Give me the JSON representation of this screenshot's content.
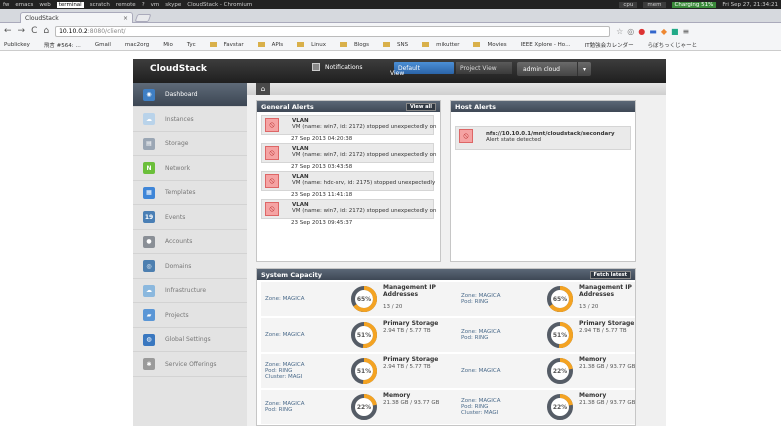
{
  "os_bar": {
    "items": [
      "fw",
      "emacs",
      "web",
      "terminal",
      "scratch",
      "remote",
      "?",
      "vm",
      "skype"
    ],
    "active": "terminal",
    "window_title": "CloudStack - Chromium",
    "cpu": "cpu",
    "mem": "mem",
    "battery": "Charging 51%",
    "clock": "Fri Sep 27, 21:34:21"
  },
  "browser": {
    "tab_title": "CloudStack",
    "tab_close": "×",
    "url_host": "10.10.0.2",
    "url_path": ":8080/client/",
    "nav_back": "←",
    "nav_forward": "→",
    "nav_reload": "C",
    "nav_home": "⌂"
  },
  "bookmarks": [
    "Publickey",
    "飛言 #564: …",
    "Gmail",
    "mac2org",
    "Mio",
    "Tyc",
    "Favstar",
    "APIs",
    "Linux",
    "Blogs",
    "SNS",
    "mikutter",
    "Movies",
    "IEEE Xplore - Ho…",
    "IT勉強会カレンダー",
    "らぼちっくじゃーと"
  ],
  "cloudstack": {
    "logo": "CloudStack",
    "notifications": "Notifications",
    "view_label": "View",
    "view_default": "Default",
    "view_project": "Project View",
    "user": "admin cloud",
    "home_icon": "⌂"
  },
  "sidebar": [
    {
      "label": "Dashboard",
      "icon": "dashboard-icon",
      "color": "#3f7fc4",
      "glyph": "◉",
      "active": true
    },
    {
      "label": "Instances",
      "icon": "cloud-icon",
      "color": "#b9d3ea",
      "glyph": "☁",
      "active": false
    },
    {
      "label": "Storage",
      "icon": "storage-icon",
      "color": "#9aa6b4",
      "glyph": "▤",
      "active": false
    },
    {
      "label": "Network",
      "icon": "network-icon",
      "color": "#6bbf3a",
      "glyph": "N",
      "active": false
    },
    {
      "label": "Templates",
      "icon": "templates-icon",
      "color": "#3f86d8",
      "glyph": "▦",
      "active": false
    },
    {
      "label": "Events",
      "icon": "calendar-icon",
      "color": "#4a7fb5",
      "glyph": "19",
      "active": false
    },
    {
      "label": "Accounts",
      "icon": "user-icon",
      "color": "#8a8f96",
      "glyph": "●",
      "active": false
    },
    {
      "label": "Domains",
      "icon": "domains-icon",
      "color": "#4d7fb0",
      "glyph": "◎",
      "active": false
    },
    {
      "label": "Infrastructure",
      "icon": "infrastructure-icon",
      "color": "#8bb8de",
      "glyph": "☁",
      "active": false
    },
    {
      "label": "Projects",
      "icon": "projects-icon",
      "color": "#5a96d6",
      "glyph": "▰",
      "active": false
    },
    {
      "label": "Global Settings",
      "icon": "globe-icon",
      "color": "#3a78c0",
      "glyph": "◍",
      "active": false
    },
    {
      "label": "Service Offerings",
      "icon": "service-icon",
      "color": "#9a9a9a",
      "glyph": "✱",
      "active": false
    }
  ],
  "general_alerts": {
    "title": "General Alerts",
    "view_all": "View all",
    "items": [
      {
        "type": "VLAN",
        "desc": "VM (name: win7, id: 2172) stopped unexpectedly on",
        "date": "27 Sep 2013 04:20:38"
      },
      {
        "type": "VLAN",
        "desc": "VM (name: win7, id: 2172) stopped unexpectedly on",
        "date": "27 Sep 2013 03:43:58"
      },
      {
        "type": "VLAN",
        "desc": "VM (name: hdc-srv, id: 2175) stopped unexpectedly",
        "date": "23 Sep 2013 11:41:18"
      },
      {
        "type": "VLAN",
        "desc": "VM (name: win7, id: 2172) stopped unexpectedly on",
        "date": "23 Sep 2013 09:45:37"
      }
    ]
  },
  "host_alerts": {
    "title": "Host Alerts",
    "items": [
      {
        "title": "nfs://10.10.0.1/mnt/cloudstack/secondary",
        "desc": "Alert state detected"
      }
    ]
  },
  "system_capacity": {
    "title": "System Capacity",
    "fetch_latest": "Fetch latest",
    "rows": [
      [
        {
          "zone": [
            "Zone: MAGICA"
          ],
          "title": "Management IP Addresses",
          "value": "13 / 20",
          "percent": 65
        },
        {
          "zone": [
            "Zone: MAGICA",
            "Pod: RING"
          ],
          "title": "Management IP Addresses",
          "value": "13 / 20",
          "percent": 65
        }
      ],
      [
        {
          "zone": [
            "Zone: MAGICA"
          ],
          "title": "Primary Storage",
          "value": "2.94 TB / 5.77 TB",
          "percent": 51
        },
        {
          "zone": [
            "Zone: MAGICA",
            "Pod: RING"
          ],
          "title": "Primary Storage",
          "value": "2.94 TB / 5.77 TB",
          "percent": 51
        }
      ],
      [
        {
          "zone": [
            "Zone: MAGICA",
            "Pod: RING",
            "Cluster: MAGI"
          ],
          "title": "Primary Storage",
          "value": "2.94 TB / 5.77 TB",
          "percent": 51
        },
        {
          "zone": [
            "Zone: MAGICA"
          ],
          "title": "Memory",
          "value": "21.38 GB / 93.77 GB",
          "percent": 22
        }
      ],
      [
        {
          "zone": [
            "Zone: MAGICA",
            "Pod: RING"
          ],
          "title": "Memory",
          "value": "21.38 GB / 93.77 GB",
          "percent": 22
        },
        {
          "zone": [
            "Zone: MAGICA",
            "Pod: RING",
            "Cluster: MAGI"
          ],
          "title": "Memory",
          "value": "21.38 GB / 93.77 GB",
          "percent": 22
        }
      ]
    ]
  }
}
